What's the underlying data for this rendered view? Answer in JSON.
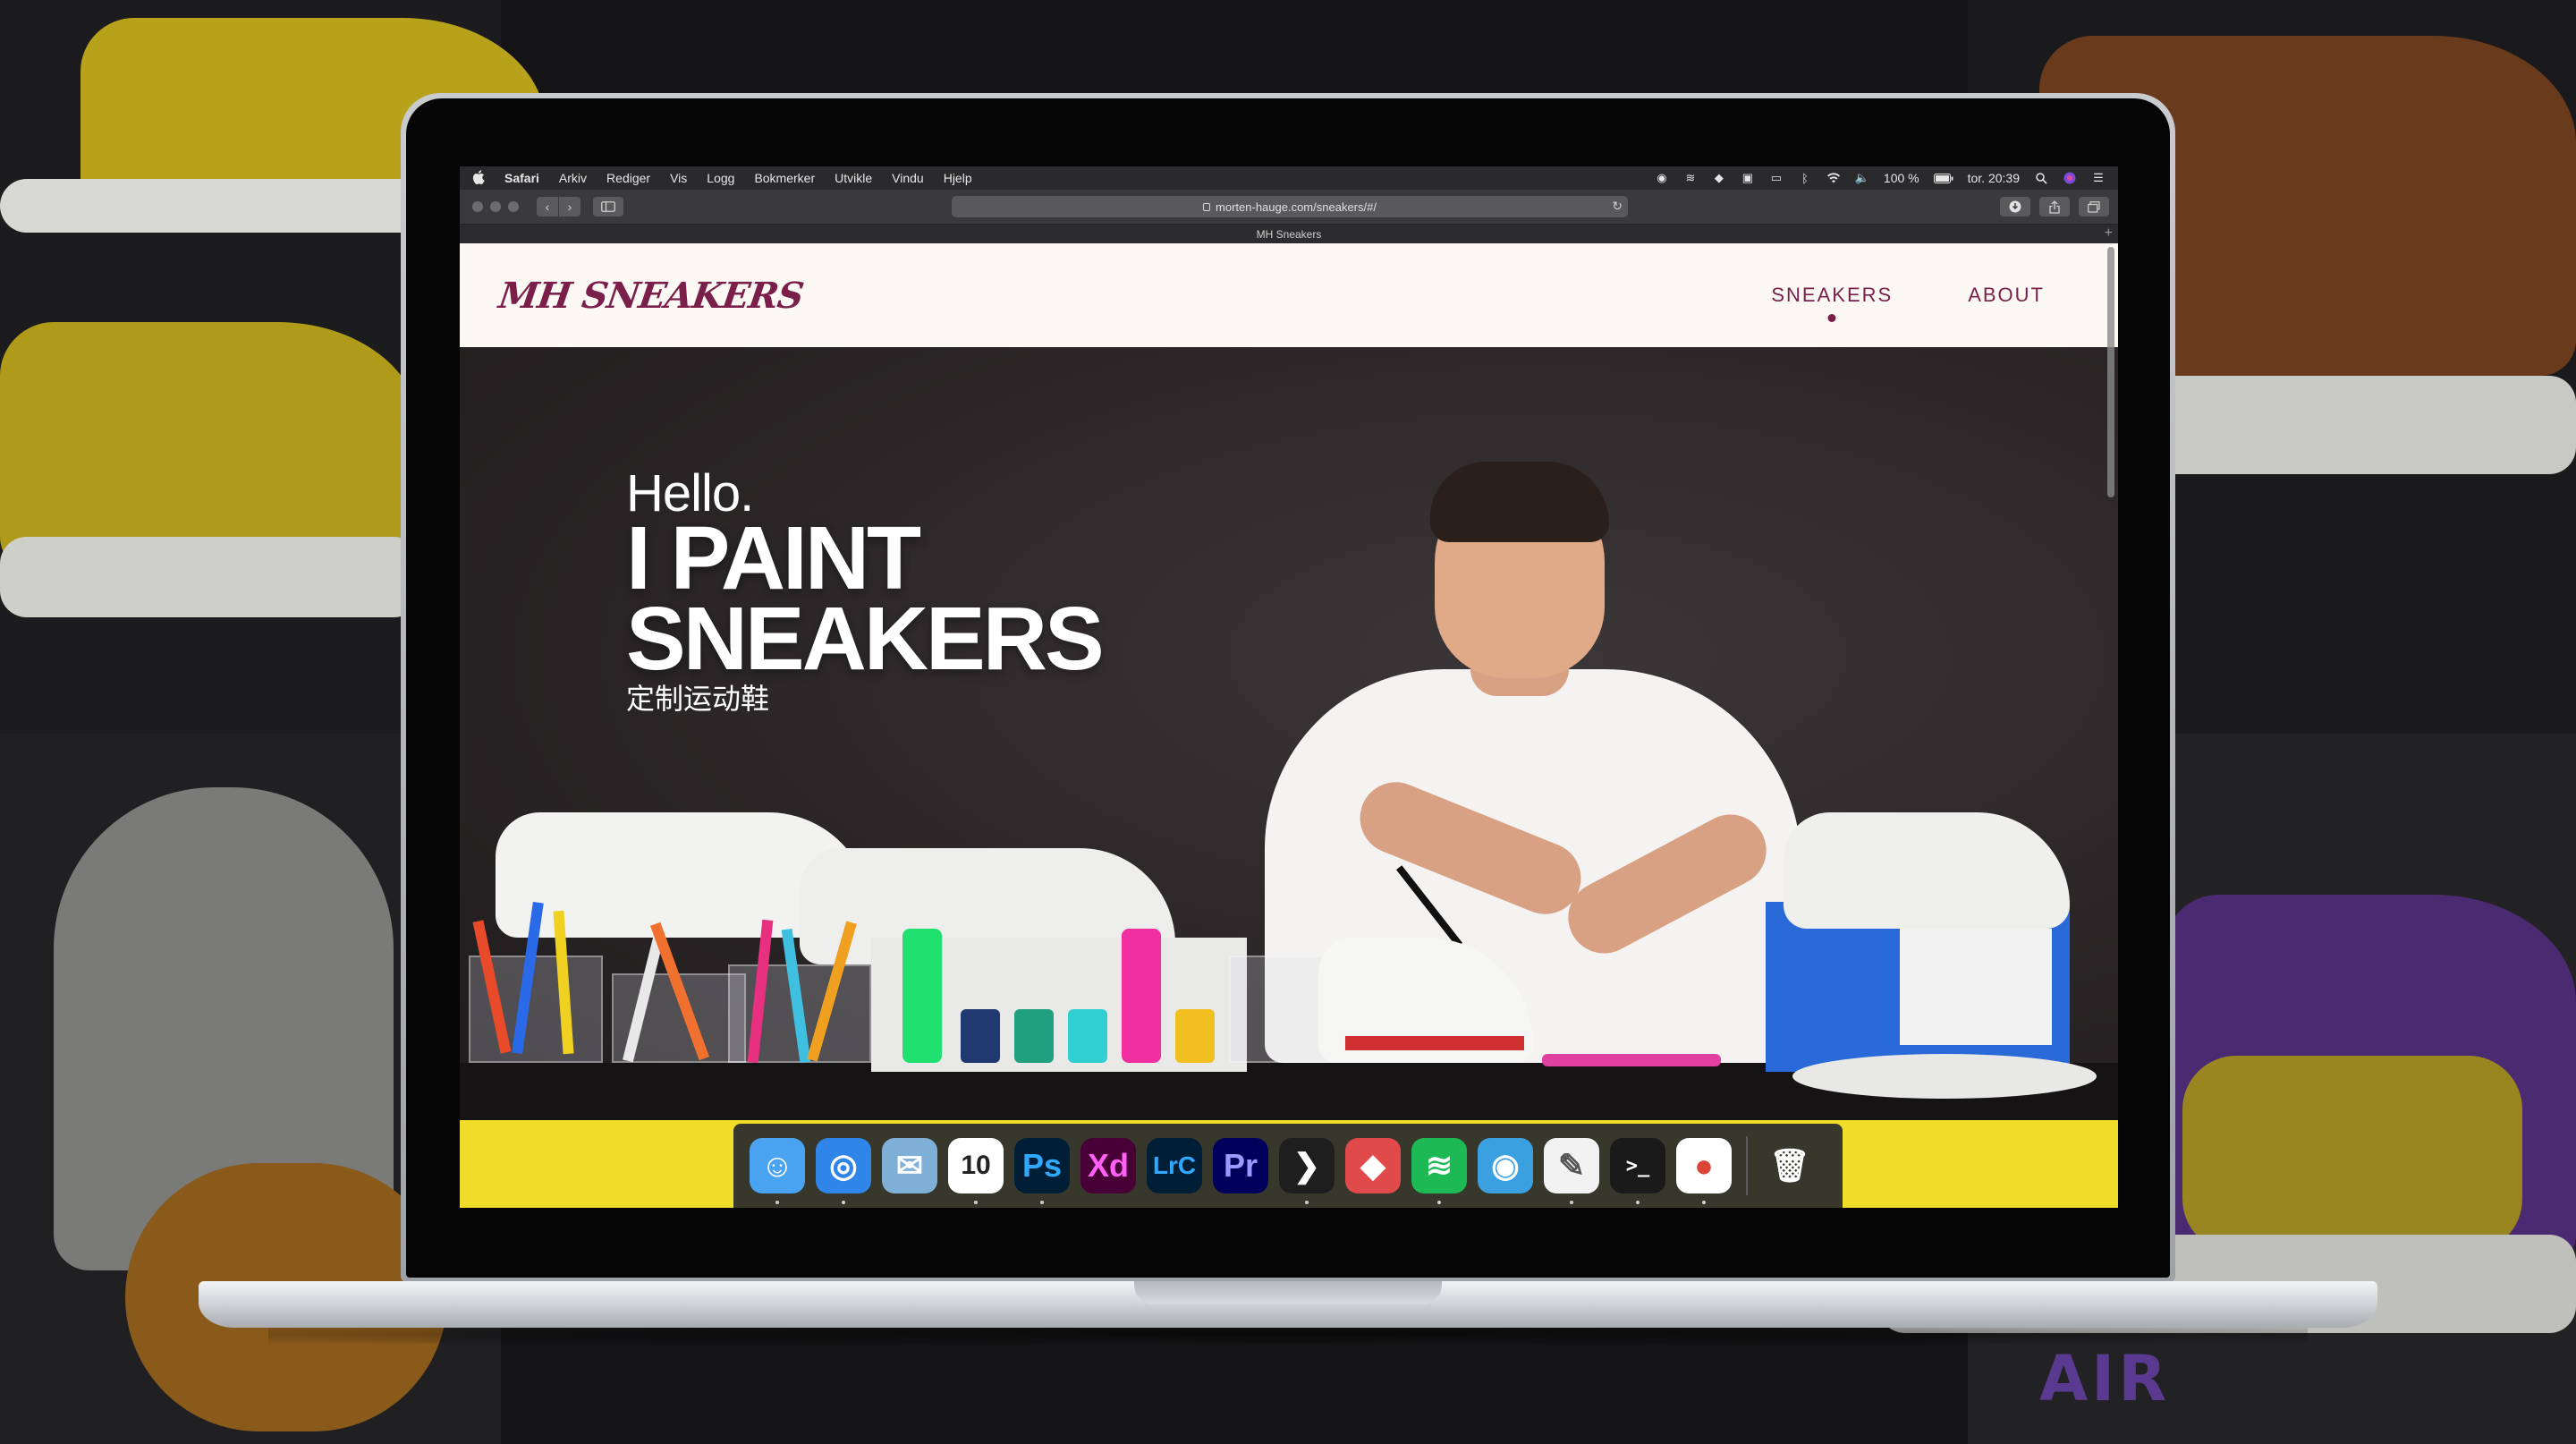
{
  "menubar": {
    "apple_icon": "apple-icon",
    "app_name": "Safari",
    "menus": [
      "Arkiv",
      "Rediger",
      "Vis",
      "Logg",
      "Bokmerker",
      "Utvikle",
      "Vindu",
      "Hjelp"
    ],
    "battery": "100 %",
    "clock": "tor. 20:39",
    "status_icons": [
      "adobe-icon",
      "spotify-icon",
      "dropbox-icon",
      "calendar-icon",
      "airplay-icon",
      "bluetooth-icon",
      "wifi-icon",
      "volume-icon"
    ]
  },
  "toolbar": {
    "back_icon": "chevron-left-icon",
    "forward_icon": "chevron-right-icon",
    "sidebar_icon": "sidebar-icon",
    "url": "morten-hauge.com/sneakers/#/",
    "reload_icon": "reload-icon",
    "download_icon": "download-icon",
    "share_icon": "share-icon",
    "tabs_icon": "tabs-overview-icon"
  },
  "tab": {
    "title": "MH Sneakers",
    "new_tab": "+"
  },
  "site": {
    "logo": "MH SNEAKERS",
    "nav": [
      {
        "label": "SNEAKERS",
        "active": true
      },
      {
        "label": "ABOUT",
        "active": false
      }
    ],
    "hero": {
      "hello": "Hello.",
      "line1": "I PAINT",
      "line2": "SNEAKERS",
      "subtitle": "定制运动鞋"
    }
  },
  "dock": {
    "apps": [
      {
        "name": "Finder",
        "glyph": "☺",
        "bg": "#4aa3f0",
        "running": true
      },
      {
        "name": "Safari",
        "glyph": "◎",
        "bg": "#2f86e8",
        "running": true
      },
      {
        "name": "Mail",
        "glyph": "✉",
        "bg": "#7fb0d8",
        "running": false
      },
      {
        "name": "Calendar",
        "glyph": "10",
        "bg": "#ffffff",
        "running": true
      },
      {
        "name": "Photoshop",
        "glyph": "Ps",
        "bg": "#001e36",
        "running": true
      },
      {
        "name": "Adobe XD",
        "glyph": "Xd",
        "bg": "#470137",
        "running": false
      },
      {
        "name": "Lightroom Classic",
        "glyph": "LrC",
        "bg": "#001e36",
        "running": false
      },
      {
        "name": "Premiere Pro",
        "glyph": "Pr",
        "bg": "#00005b",
        "running": false
      },
      {
        "name": "VS Code",
        "glyph": "❯",
        "bg": "#1e1e1e",
        "running": true
      },
      {
        "name": "Tower",
        "glyph": "◆",
        "bg": "#e04a4a",
        "running": false
      },
      {
        "name": "Spotify",
        "glyph": "≋",
        "bg": "#1db954",
        "running": true
      },
      {
        "name": "Tweetbot",
        "glyph": "◉",
        "bg": "#3aa0e0",
        "running": false
      },
      {
        "name": "TextEdit",
        "glyph": "✎",
        "bg": "#f2f2f2",
        "running": true
      },
      {
        "name": "Terminal",
        "glyph": ">_",
        "bg": "#1a1a1a",
        "running": true
      },
      {
        "name": "Chrome",
        "glyph": "●",
        "bg": "#ffffff",
        "running": true
      },
      {
        "name": "Trash",
        "glyph": "🗑",
        "bg": "transparent",
        "running": false
      }
    ]
  },
  "colors": {
    "brand": "#7a1f4a",
    "nav_bg": "#fcf8f4",
    "dock_strip": "#f0dd2a"
  }
}
